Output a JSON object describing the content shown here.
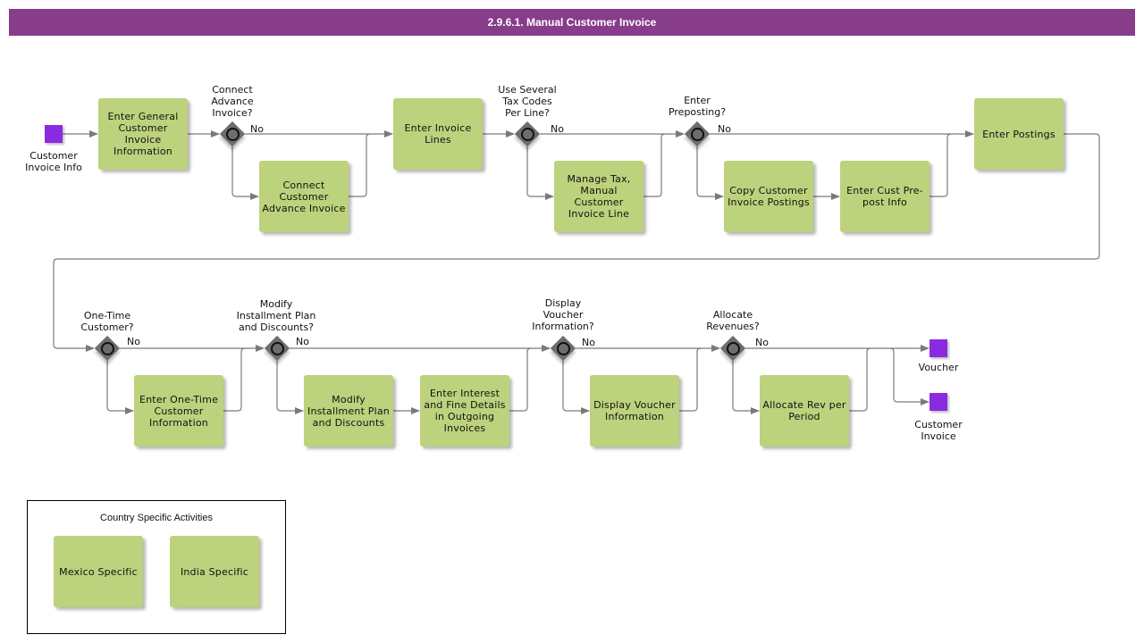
{
  "header": {
    "title": "2.9.6.1. Manual Customer Invoice"
  },
  "colors": {
    "title_bar": "#873d8a",
    "task_fill": "#bdd27c",
    "event_fill": "#8a2be2",
    "gateway_fill": "#6d6d6d",
    "connector": "#7a7a7a"
  },
  "events": {
    "start": {
      "label": "Customer\nInvoice Info"
    },
    "end_voucher": {
      "label": "Voucher"
    },
    "end_invoice": {
      "label": "Customer\nInvoice"
    }
  },
  "tasks": {
    "enter_general": "Enter General\nCustomer\nInvoice\nInformation",
    "connect_advance": "Connect\nCustomer\nAdvance Invoice",
    "enter_lines": "Enter Invoice\nLines",
    "manage_tax": "Manage Tax,\nManual\nCustomer\nInvoice Line",
    "copy_postings": "Copy Customer\nInvoice Postings",
    "enter_prepost": "Enter Cust Pre-\npost Info",
    "enter_postings": "Enter Postings",
    "one_time": "Enter One-Time\nCustomer\nInformation",
    "modify_installment": "Modify\nInstallment Plan\nand Discounts",
    "interest_fine": "Enter Interest\nand Fine Details\nin Outgoing\nInvoices",
    "display_voucher": "Display Voucher\nInformation",
    "allocate_rev": "Allocate Rev per\nPeriod"
  },
  "gateways": {
    "g1": {
      "question": "Connect\nAdvance\nInvoice?",
      "no_label": "No"
    },
    "g2": {
      "question": "Use Several\nTax Codes\nPer Line?",
      "no_label": "No"
    },
    "g3": {
      "question": "Enter\nPreposting?",
      "no_label": "No"
    },
    "g4": {
      "question": "One-Time\nCustomer?",
      "no_label": "No"
    },
    "g5": {
      "question": "Modify\nInstallment Plan\nand Discounts?",
      "no_label": "No"
    },
    "g6": {
      "question": "Display\nVoucher\nInformation?",
      "no_label": "No"
    },
    "g7": {
      "question": "Allocate\nRevenues?",
      "no_label": "No"
    }
  },
  "legend": {
    "title": "Country Specific Activities",
    "items": [
      "Mexico Specific",
      "India Specific"
    ]
  }
}
